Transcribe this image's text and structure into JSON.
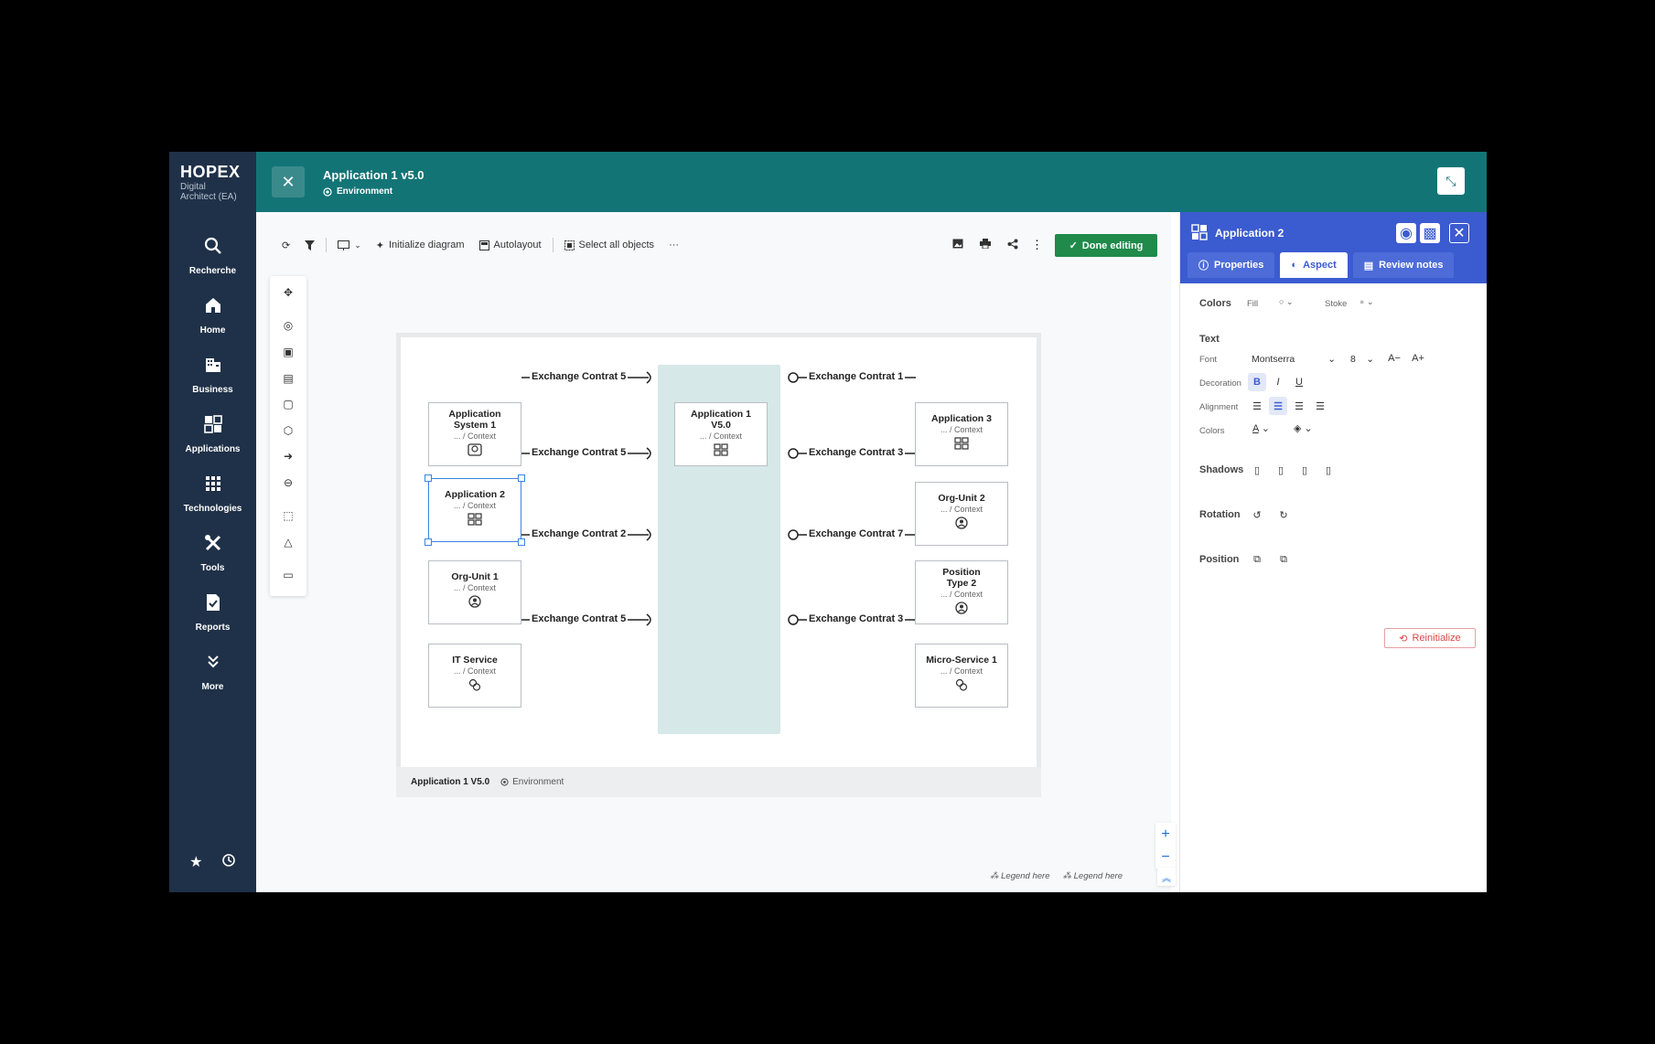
{
  "app": {
    "brand": "HOPEX",
    "brand_sub1": "Digital",
    "brand_sub2": "Architect (EA)"
  },
  "nav": {
    "search": "Recherche",
    "home": "Home",
    "business": "Business",
    "applications": "Applications",
    "technologies": "Technologies",
    "tools": "Tools",
    "reports": "Reports",
    "more": "More"
  },
  "header": {
    "title": "Application 1 v5.0",
    "subtitle": "Environment"
  },
  "toolbar": {
    "init_diagram": "Initialize diagram",
    "autolayout": "Autolayout",
    "select_all": "Select all objects",
    "more": "···",
    "done": "Done editing"
  },
  "diagram": {
    "context": "... / Context",
    "left_nodes": [
      {
        "title1": "Application",
        "title2": "System 1"
      },
      {
        "title1": "Application 2",
        "title2": ""
      },
      {
        "title1": "Org-Unit 1",
        "title2": ""
      },
      {
        "title1": "IT Service",
        "title2": ""
      }
    ],
    "center_node": {
      "title1": "Application 1",
      "title2": "V5.0"
    },
    "right_nodes": [
      {
        "title1": "Application 3",
        "title2": ""
      },
      {
        "title1": "Org-Unit 2",
        "title2": ""
      },
      {
        "title1": "Position",
        "title2": "Type 2"
      },
      {
        "title1": "Micro-Service 1",
        "title2": ""
      }
    ],
    "left_contracts": [
      "Exchange Contrat 5",
      "Exchange Contrat 5",
      "Exchange Contrat 2",
      "Exchange Contrat 5"
    ],
    "right_contracts": [
      "Exchange Contrat 1",
      "Exchange Contrat 3",
      "Exchange Contrat 7",
      "Exchange Contrat 3"
    ],
    "footer_title": "Application 1 V5.0",
    "footer_env": "Environment",
    "legend1": "Legend here",
    "legend2": "Legend here"
  },
  "panel": {
    "title": "Application 2",
    "tabs": [
      "Properties",
      "Aspect",
      "Review notes"
    ],
    "active_tab": "Aspect",
    "colors": "Colors",
    "fill": "Fill",
    "stroke": "Stoke",
    "text": "Text",
    "font_label": "Font",
    "font_value": "Montserra",
    "font_size": "8",
    "decoration": "Decoration",
    "alignment": "Alignment",
    "text_colors": "Colors",
    "shadows": "Shadows",
    "rotation": "Rotation",
    "position": "Position",
    "reinit": "Reinitialize",
    "accent": "#3b5bd0"
  },
  "colors": {
    "nav_bg": "#1f3148",
    "header_bg": "#137476",
    "done_btn": "#1f8a4a",
    "selection": "#3a84e6"
  }
}
